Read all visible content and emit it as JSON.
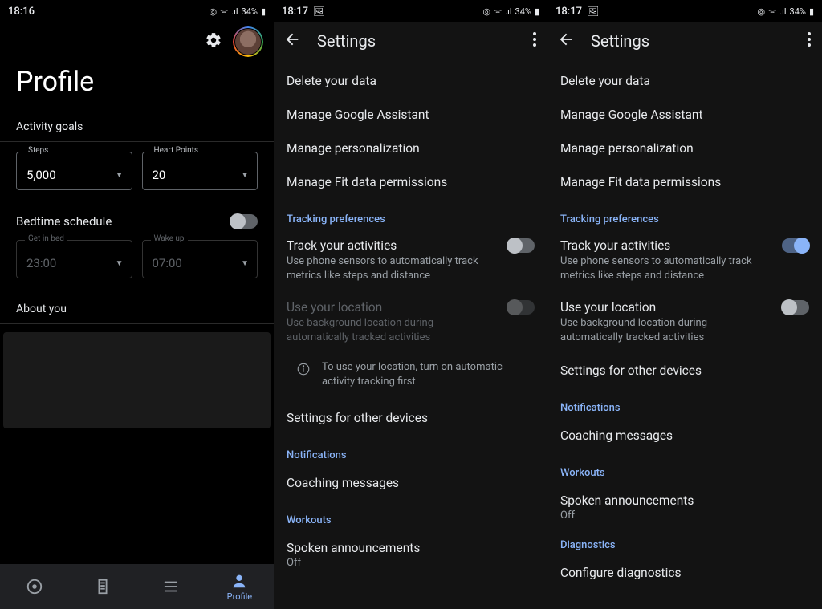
{
  "s1": {
    "status": {
      "time": "18:16",
      "extras": "34%"
    },
    "title": "Profile",
    "activityGoals": {
      "label": "Activity goals",
      "steps": {
        "label": "Steps",
        "value": "5,000"
      },
      "heart": {
        "label": "Heart Points",
        "value": "20"
      }
    },
    "bedtime": {
      "label": "Bedtime schedule",
      "getIn": {
        "label": "Get in bed",
        "value": "23:00"
      },
      "wake": {
        "label": "Wake up",
        "value": "07:00"
      }
    },
    "about": {
      "label": "About you"
    },
    "nav": {
      "profile": "Profile"
    }
  },
  "s2": {
    "status": {
      "time": "18:17",
      "extras": "34%"
    },
    "title": "Settings",
    "items": {
      "delete": "Delete your data",
      "assistant": "Manage Google Assistant",
      "personalization": "Manage personalization",
      "fitperms": "Manage Fit data permissions"
    },
    "section_tracking": "Tracking preferences",
    "track": {
      "title": "Track your activities",
      "desc": "Use phone sensors to automatically track metrics like steps and distance"
    },
    "loc": {
      "title": "Use your location",
      "desc": "Use background location during automatically tracked activities"
    },
    "info": "To use your location, turn on automatic activity tracking first",
    "otherdev": "Settings for other devices",
    "section_notif": "Notifications",
    "coaching": "Coaching messages",
    "section_workouts": "Workouts",
    "spoken": {
      "title": "Spoken announcements",
      "value": "Off"
    }
  },
  "s3": {
    "status": {
      "time": "18:17",
      "extras": "34%"
    },
    "title": "Settings",
    "items": {
      "delete": "Delete your data",
      "assistant": "Manage Google Assistant",
      "personalization": "Manage personalization",
      "fitperms": "Manage Fit data permissions"
    },
    "section_tracking": "Tracking preferences",
    "track": {
      "title": "Track your activities",
      "desc": "Use phone sensors to automatically track metrics like steps and distance"
    },
    "loc": {
      "title": "Use your location",
      "desc": "Use background location during automatically tracked activities"
    },
    "otherdev": "Settings for other devices",
    "section_notif": "Notifications",
    "coaching": "Coaching messages",
    "section_workouts": "Workouts",
    "spoken": {
      "title": "Spoken announcements",
      "value": "Off"
    },
    "section_diag": "Diagnostics",
    "configdiag": "Configure diagnostics"
  }
}
